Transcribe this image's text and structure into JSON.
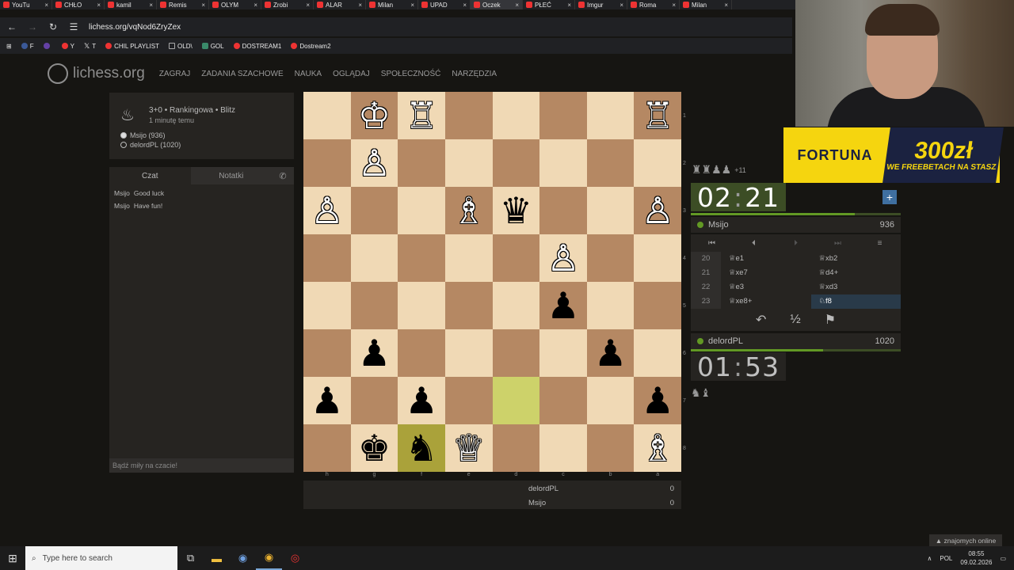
{
  "browser": {
    "tabs": [
      "YouTu",
      "CHŁO",
      "kamil",
      "Remis",
      "OLYM",
      "Zrobi",
      "ALAR",
      "Milan",
      "UPAD",
      "Oczek",
      "PŁEĆ",
      "Imgur",
      "Roma",
      "Milan"
    ],
    "active_tab_index": 9,
    "url": "lichess.org/vqNod6ZryZex",
    "bookmarks": [
      {
        "label": "F",
        "icon": "facebook-icon"
      },
      {
        "label": "",
        "icon": "twitch-icon"
      },
      {
        "label": "Y",
        "icon": "youtube-icon"
      },
      {
        "label": "T",
        "icon": "x-icon"
      },
      {
        "label": "CHIL PLAYLIST",
        "icon": "youtube-icon"
      },
      {
        "label": "OLD\\",
        "icon": "folder-icon"
      },
      {
        "label": "GOL",
        "icon": "g-icon"
      },
      {
        "label": "DOSTREAM1",
        "icon": "youtube-icon"
      },
      {
        "label": "Dostream2",
        "icon": "youtube-icon"
      }
    ]
  },
  "site": {
    "logo": "lichess.org",
    "nav": [
      "ZAGRAJ",
      "ZADANIA SZACHOWE",
      "NAUKA",
      "OGLĄDAJ",
      "SPOŁECZNOŚĆ",
      "NARZĘDZIA"
    ]
  },
  "game": {
    "type": "3+0 • Rankingowa • Blitz",
    "time_ago": "1 minutę temu",
    "white": "Msijo (936)",
    "black": "delordPL (1020)"
  },
  "chat": {
    "tab_chat": "Czat",
    "tab_notes": "Notatki",
    "messages": [
      {
        "user": "Msijo",
        "text": "Good luck"
      },
      {
        "user": "Msijo",
        "text": "Have fun!"
      }
    ],
    "placeholder": "Bądź miły na czacie!"
  },
  "board": {
    "flipped": true,
    "rows": [
      [
        "",
        "♔",
        "♖",
        "",
        "",
        "",
        "",
        "♖"
      ],
      [
        "",
        "♙",
        "",
        "",
        "",
        "",
        "",
        ""
      ],
      [
        "♙",
        "",
        "",
        "♗",
        "♛",
        "",
        "",
        "♙"
      ],
      [
        "",
        "",
        "",
        "",
        "",
        "♙",
        "",
        ""
      ],
      [
        "",
        "",
        "",
        "",
        "",
        "♟",
        "",
        ""
      ],
      [
        "",
        "♟",
        "",
        "",
        "",
        "",
        "♟",
        ""
      ],
      [
        "♟",
        "",
        "♟",
        "",
        "",
        "",
        "",
        "♟"
      ],
      [
        "",
        "♚",
        "♞",
        "♕",
        "",
        "",
        "",
        "♗"
      ]
    ],
    "highlight": [
      [
        6,
        4
      ],
      [
        7,
        2
      ]
    ],
    "rank_labels": [
      "1",
      "2",
      "3",
      "4",
      "5",
      "6",
      "7",
      "8"
    ],
    "file_labels": [
      "h",
      "g",
      "f",
      "e",
      "d",
      "c",
      "b",
      "a"
    ]
  },
  "score": [
    {
      "name": "delordPL",
      "points": "0"
    },
    {
      "name": "Msijo",
      "points": "0"
    }
  ],
  "top_player": {
    "name": "Msijo",
    "rating": "936",
    "clock_min": "02",
    "clock_sec": "21",
    "captured": "♜♜♟♟",
    "material": "+11",
    "time_fraction": 0.78
  },
  "bottom_player": {
    "name": "delordPL",
    "rating": "1020",
    "clock_min": "01",
    "clock_sec": "53",
    "captured": "♞♝",
    "time_fraction": 0.63
  },
  "controls": [
    "⏮",
    "⏴",
    "⏵",
    "⏭",
    "≡"
  ],
  "moves": [
    {
      "n": "20",
      "w": "♕e1",
      "b": "♕xb2"
    },
    {
      "n": "21",
      "w": "♕xe7",
      "b": "♕d4+"
    },
    {
      "n": "22",
      "w": "♕e3",
      "b": "♕xd3"
    },
    {
      "n": "23",
      "w": "♕xe8+",
      "b": "♘f8"
    }
  ],
  "actions": {
    "takeback": "↶",
    "draw": "½",
    "resign": "⚑"
  },
  "ad": {
    "brand": "FORTUNA",
    "amount": "300zł",
    "tagline": "WE FREEBETACH NA STASZ"
  },
  "friends": "znajomych online",
  "taskbar": {
    "search": "Type here to search",
    "lang": "POL",
    "time": "08:55",
    "date": "09.02.2026"
  }
}
